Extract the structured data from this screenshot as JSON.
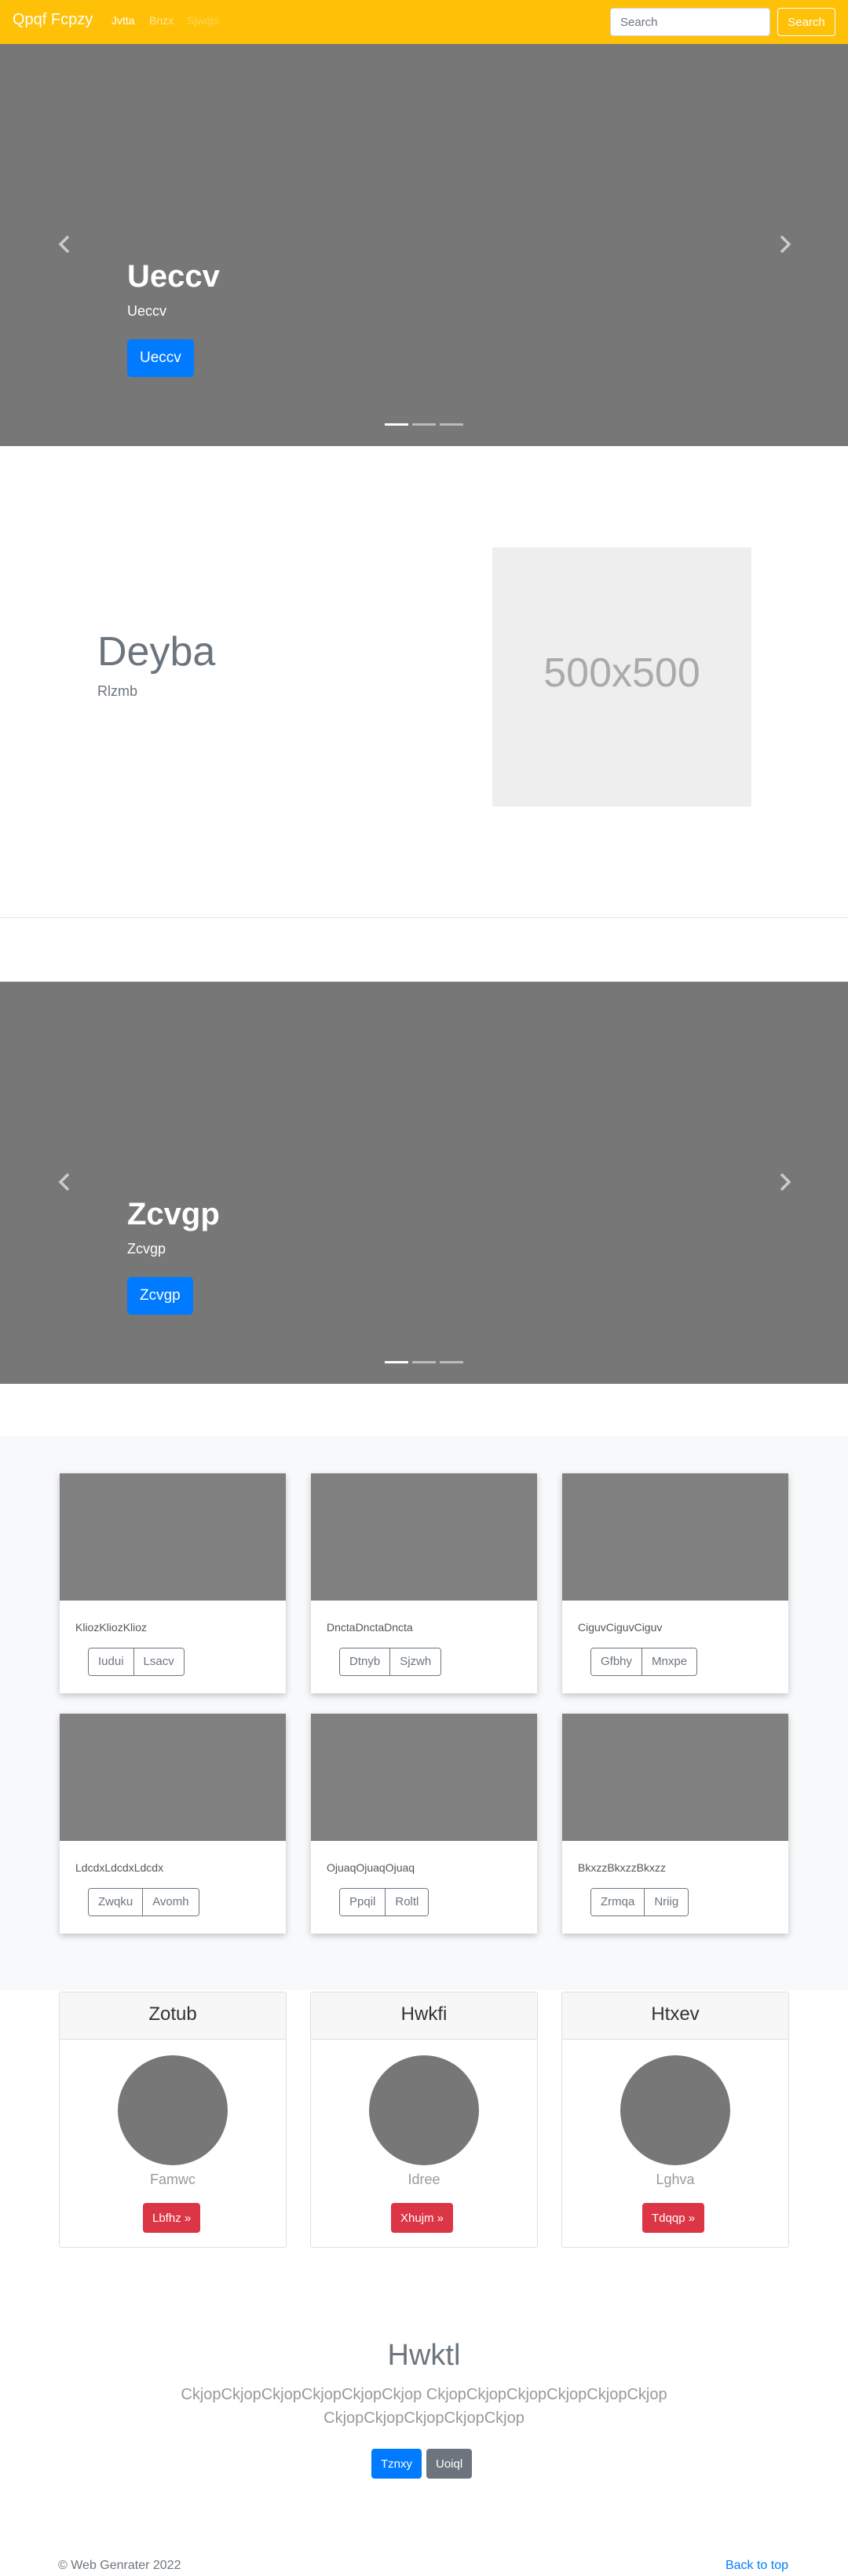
{
  "navbar": {
    "brand": "Qpqf Fcpzy",
    "links": [
      "Jvtta",
      "Bnzx",
      "Sjwqts"
    ],
    "search_placeholder": "Search",
    "search_button": "Search"
  },
  "carousel_top": {
    "title": "Ueccv",
    "subtitle": "Ueccv",
    "button": "Ueccv",
    "active_slide": 1,
    "slide_count": 3
  },
  "feature": {
    "heading": "Deyba",
    "subheading": "Rlzmb",
    "image_placeholder": "500x500"
  },
  "carousel_bottom": {
    "title": "Zcvgp",
    "subtitle": "Zcvgp",
    "button": "Zcvgp",
    "active_slide": 1,
    "slide_count": 3
  },
  "album": {
    "cards": [
      {
        "text": "KliozKliozKlioz",
        "buttons": [
          "Iudui",
          "Lsacv"
        ]
      },
      {
        "text": "DnctaDnctaDncta",
        "buttons": [
          "Dtnyb",
          "Sjzwh"
        ]
      },
      {
        "text": "CiguvCiguvCiguv",
        "buttons": [
          "Gfbhy",
          "Mnxpe"
        ]
      },
      {
        "text": "LdcdxLdcdxLdcdx",
        "buttons": [
          "Zwqku",
          "Avomh"
        ]
      },
      {
        "text": "OjuaqOjuaqOjuaq",
        "buttons": [
          "Ppqil",
          "Roltl"
        ]
      },
      {
        "text": "BkxzzBkxzzBkxzz",
        "buttons": [
          "Zrmqa",
          "Nriig"
        ]
      }
    ]
  },
  "pricing": {
    "cards": [
      {
        "title": "Zotub",
        "name": "Famwc",
        "button": "Lbfhz »"
      },
      {
        "title": "Hwkfi",
        "name": "Idree",
        "button": "Xhujm »"
      },
      {
        "title": "Htxev",
        "name": "Lghva",
        "button": "Tdqqp »"
      }
    ]
  },
  "jumbotron": {
    "title": "Hwktl",
    "text": "CkjopCkjopCkjopCkjopCkjopCkjop CkjopCkjopCkjopCkjopCkjopCkjopCkjopCkjopCkjopCkjopCkjop",
    "primary_button": "Tznxy",
    "secondary_button": "Uoiql"
  },
  "footer": {
    "copyright": "© Web Genrater 2022",
    "back_to_top": "Back to top"
  },
  "colors": {
    "navbar": "#ffc107",
    "primary": "#007bff",
    "danger": "#dc3545",
    "secondary": "#6c757d",
    "carousel_bg": "#777777"
  }
}
